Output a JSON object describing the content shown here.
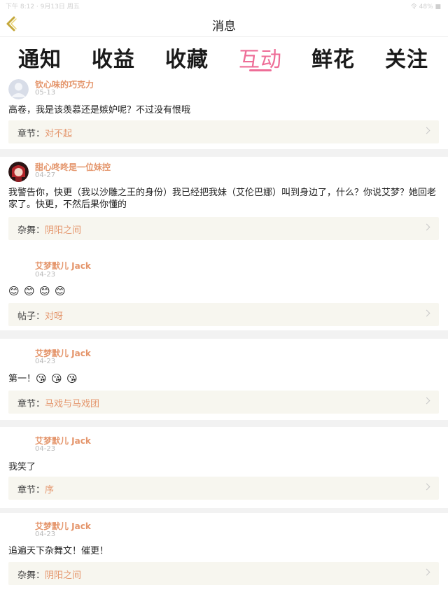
{
  "statusbar": {
    "left": "下午 8:12 · 9月13日 周五",
    "right": "令 48% ■"
  },
  "header": {
    "title": "消息"
  },
  "tabs": [
    "通知",
    "收益",
    "收藏",
    "互动",
    "鲜花",
    "关注"
  ],
  "active_tab_index": 3,
  "colors": {
    "accent": "#ee6d97",
    "name": "#e4956b",
    "ref_bg": "#f7f6ef"
  },
  "items": [
    {
      "user": "钦心味的巧克力",
      "date": "05-13",
      "content": "高卷，我是该羡慕还是嫉妒呢？不过没有恨哦",
      "ref_label": "章节：",
      "ref_value": "对不起",
      "avatar": "default-avatar"
    },
    {
      "user": "甜心咚咚是一位妹控",
      "date": "04-27",
      "content": "我警告你，快更（我以沙雕之王的身份）我已经把我妹（艾伦巴娜）叫到身边了，什么？你说艾梦？她回老家了。快更，不然后果你懂的",
      "ref_label": "杂舞：",
      "ref_value": "阴阳之间",
      "avatar": "anime-avatar"
    },
    {
      "user": "艾梦默儿 Jack",
      "date": "04-23",
      "content": "😊😊😊😊",
      "ref_label": "帖子：",
      "ref_value": "对呀",
      "avatar": "none"
    },
    {
      "user": "艾梦默儿 Jack",
      "date": "04-23",
      "content": "第一！😘😘😘",
      "ref_label": "章节：",
      "ref_value": "马戏与马戏团",
      "avatar": "none"
    },
    {
      "user": "艾梦默儿 Jack",
      "date": "04-23",
      "content": "我笑了",
      "ref_label": "章节：",
      "ref_value": "序",
      "avatar": "none"
    },
    {
      "user": "艾梦默儿 Jack",
      "date": "04-23",
      "content": "追遍天下杂舞文！催更！",
      "ref_label": "杂舞：",
      "ref_value": "阴阳之间",
      "avatar": "none"
    }
  ]
}
